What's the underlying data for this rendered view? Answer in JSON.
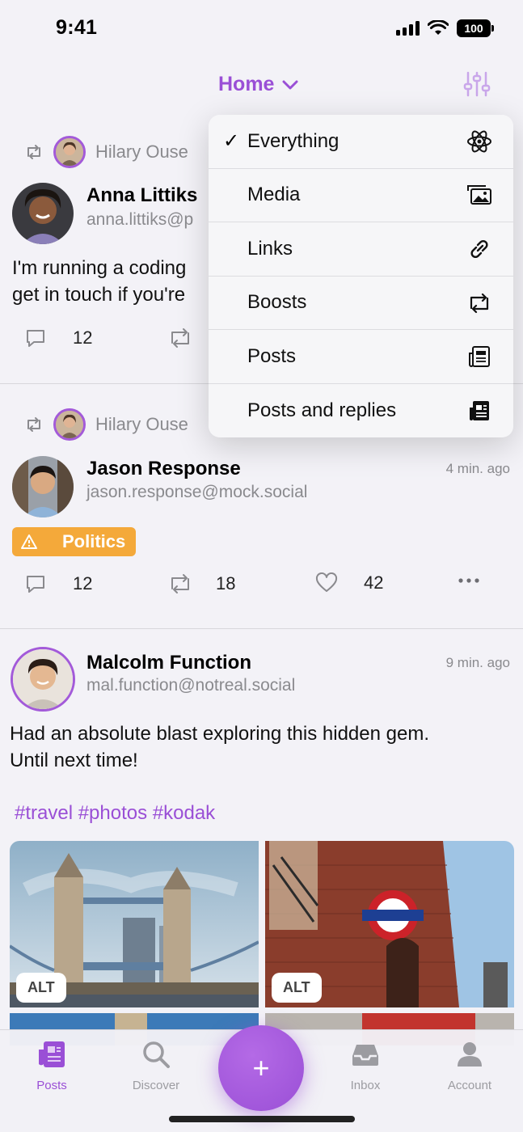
{
  "status": {
    "time": "9:41",
    "battery": "100"
  },
  "header": {
    "title": "Home"
  },
  "dropdown": {
    "items": [
      {
        "label": "Everything",
        "checked": true,
        "icon": "atom-icon"
      },
      {
        "label": "Media",
        "checked": false,
        "icon": "photos-icon"
      },
      {
        "label": "Links",
        "checked": false,
        "icon": "link-icon"
      },
      {
        "label": "Boosts",
        "checked": false,
        "icon": "boost-icon"
      },
      {
        "label": "Posts",
        "checked": false,
        "icon": "newspaper-icon"
      },
      {
        "label": "Posts and replies",
        "checked": false,
        "icon": "newspaper-filled-icon"
      }
    ],
    "check_glyph": "✓"
  },
  "posts": [
    {
      "booster": "Hilary Ouse",
      "display_name": "Anna Littiks",
      "handle": "anna.littiks@p",
      "text_line1": "I'm running a coding ",
      "text_line2": "get in touch if you're ",
      "replies": "12"
    },
    {
      "booster": "Hilary Ouse",
      "display_name": "Jason Response",
      "handle": "jason.response@mock.social",
      "time": "4 min. ago",
      "content_warning": "Politics",
      "replies": "12",
      "boosts": "18",
      "favourites": "42"
    },
    {
      "display_name": "Malcolm Function",
      "handle": "mal.function@notreal.social",
      "time": "9 min. ago",
      "text_line1": "Had an absolute blast exploring this hidden gem.",
      "text_line2": "Until next time!",
      "hashtags": "#travel #photos #kodak",
      "alt_label": "ALT"
    }
  ],
  "tabs": [
    {
      "label": "Posts",
      "active": true
    },
    {
      "label": "Discover",
      "active": false
    },
    {
      "label": "Inbox",
      "active": false
    },
    {
      "label": "Account",
      "active": false
    }
  ],
  "fab": {
    "glyph": "+"
  },
  "colors": {
    "accent": "#9a4fd6",
    "warning": "#f4a93a",
    "muted": "#8a8a8e"
  }
}
